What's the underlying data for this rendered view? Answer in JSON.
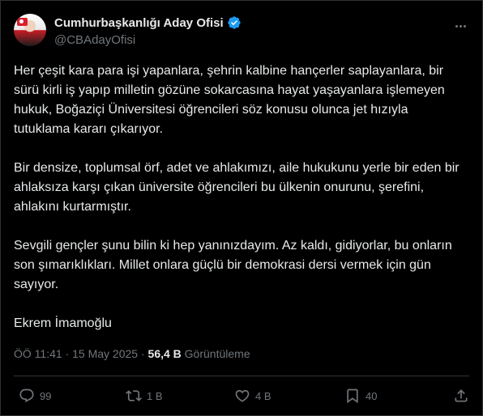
{
  "author": {
    "display_name": "Cumhurbaşkanlığı Aday Ofisi",
    "handle": "@CBAdayOfisi",
    "verified_icon": "verified-badge-icon",
    "verified_color": "#1d9bf0"
  },
  "tweet": {
    "paragraphs": [
      "Her çeşit kara para işi yapanlara, şehrin kalbine hançerler saplayanlara, bir sürü kirli iş yapıp milletin gözüne sokarcasına hayat yaşayanlara işlemeyen hukuk, Boğaziçi Üniversitesi öğrencileri söz konusu olunca jet hızıyla tutuklama kararı çıkarıyor.",
      "Bir densize, toplumsal örf, adet ve ahlakımızı, aile hukukunu yerle bir eden bir ahlaksıza karşı çıkan üniversite öğrencileri bu ülkenin onurunu, şerefini, ahlakını kurtarmıştır.",
      "Sevgili gençler şunu bilin ki hep yanınızdayım. Az kaldı, gidiyorlar, bu onların son şımarıklıkları. Millet onlara güçlü bir demokrasi dersi vermek için gün sayıyor.",
      "Ekrem İmamoğlu"
    ],
    "time": "ÖÖ 11:41",
    "separator": "·",
    "date": "15 May 2025",
    "views_count": "56,4 B",
    "views_label": "Görüntüleme"
  },
  "actions": {
    "replies": "99",
    "retweets": "1 B",
    "likes": "4 B",
    "bookmarks": "40"
  },
  "colors": {
    "background": "#000000",
    "text": "#e7e9ea",
    "secondary": "#71767b",
    "border": "#2f3336"
  }
}
